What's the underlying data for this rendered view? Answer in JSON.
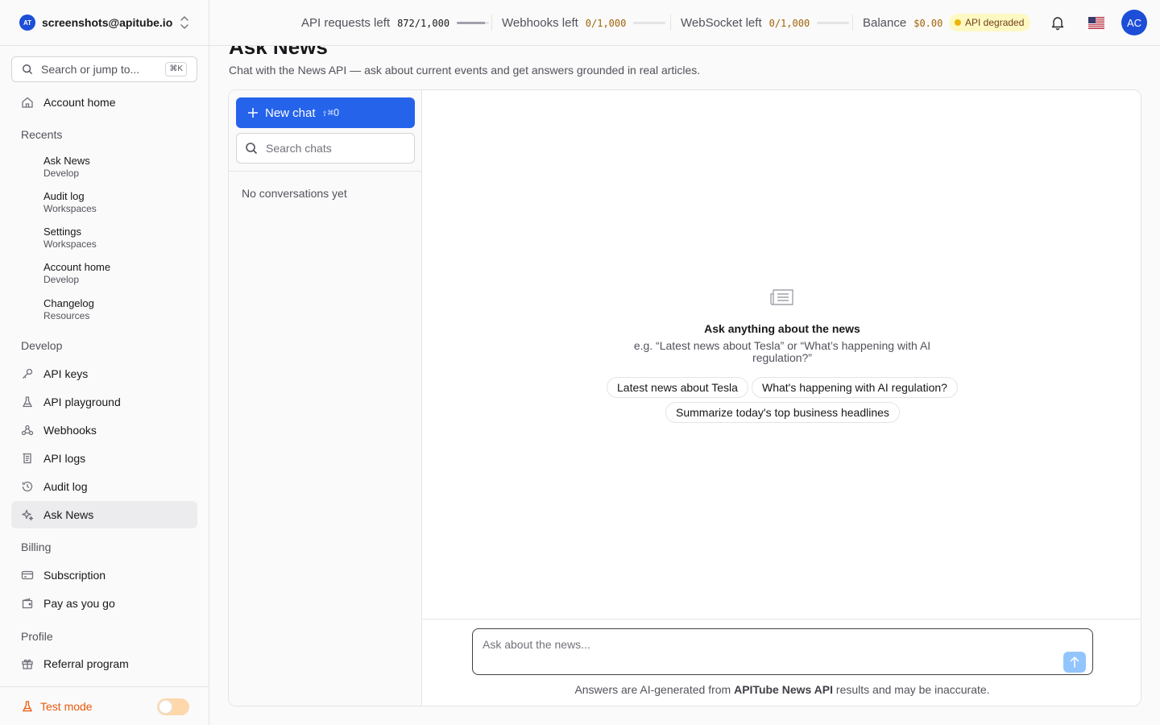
{
  "account": {
    "email": "screenshots@apitube.io",
    "logo_text": "AT"
  },
  "search": {
    "placeholder": "Search or jump to...",
    "shortcut": "⌘K"
  },
  "nav": {
    "home": "Account home",
    "recents_title": "Recents",
    "recents": [
      {
        "title": "Ask News",
        "sub": "Develop"
      },
      {
        "title": "Audit log",
        "sub": "Workspaces"
      },
      {
        "title": "Settings",
        "sub": "Workspaces"
      },
      {
        "title": "Account home",
        "sub": "Develop"
      },
      {
        "title": "Changelog",
        "sub": "Resources"
      }
    ],
    "develop_title": "Develop",
    "develop": [
      "API keys",
      "API playground",
      "Webhooks",
      "API logs",
      "Audit log",
      "Ask News"
    ],
    "billing_title": "Billing",
    "billing": [
      "Subscription",
      "Pay as you go"
    ],
    "profile_title": "Profile",
    "profile": [
      "Referral program"
    ],
    "active": "Ask News"
  },
  "test_mode": {
    "label": "Test mode",
    "enabled": false
  },
  "topbar": {
    "meters": [
      {
        "label": "API requests left",
        "value": "872/1,000",
        "value_color": "#18181b",
        "fraction": 0.872
      },
      {
        "label": "Webhooks left",
        "value": "0/1,000",
        "value_color": "#a16207",
        "fraction": 0
      },
      {
        "label": "WebSocket left",
        "value": "0/1,000",
        "value_color": "#a16207",
        "fraction": 0
      }
    ],
    "balance_label": "Balance",
    "balance_value": "$0.00",
    "status": "API degraded",
    "avatar": "AC"
  },
  "page": {
    "title": "Ask News",
    "subtitle": "Chat with the News API — ask about current events and get answers grounded in real articles."
  },
  "chat": {
    "new_chat": "New chat",
    "new_chat_shortcut": "⇧⌘O",
    "search_placeholder": "Search chats",
    "empty_list": "No conversations yet",
    "empty_title": "Ask anything about the news",
    "empty_hint": "e.g. “Latest news about Tesla” or “What’s happening with AI regulation?”",
    "suggestions": [
      "Latest news about Tesla",
      "What's happening with AI regulation?",
      "Summarize today's top business headlines"
    ],
    "composer_placeholder": "Ask about the news...",
    "disclaimer_pre": "Answers are AI-generated from",
    "disclaimer_brand": "APITube News API",
    "disclaimer_post": "results and may be inaccurate."
  },
  "colors": {
    "accent": "#2563eb",
    "warning": "#ea580c",
    "status_dot": "#eab308"
  }
}
